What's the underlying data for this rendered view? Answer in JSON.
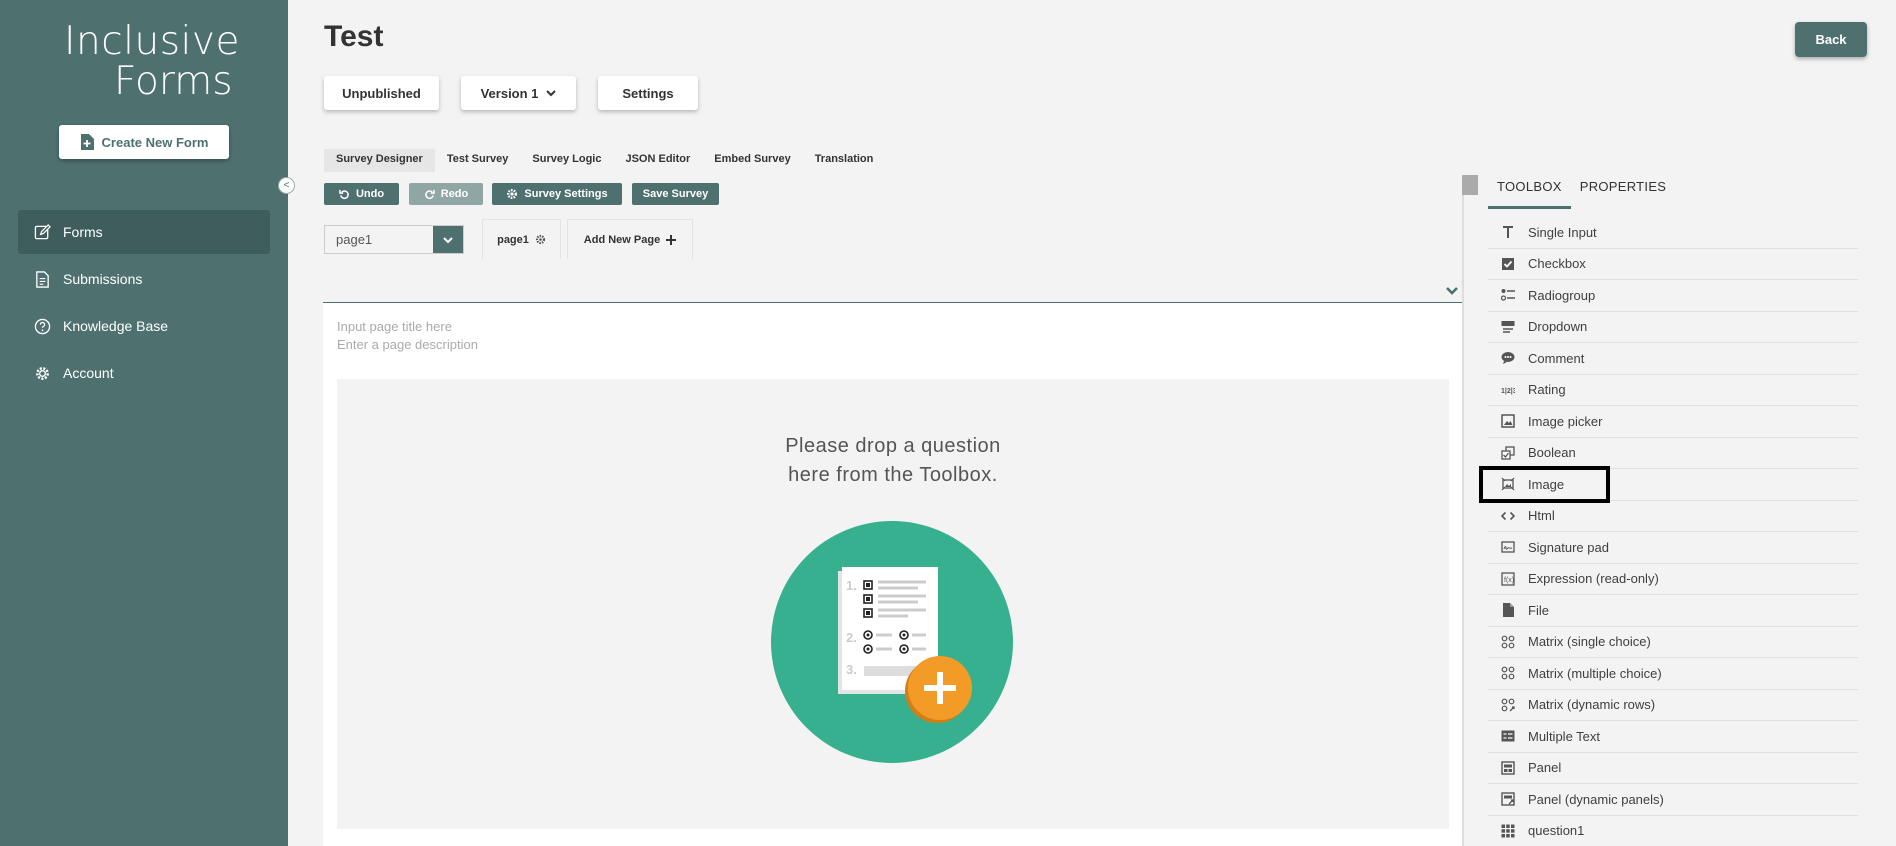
{
  "sidebar": {
    "logo_line1": "Inclusive",
    "logo_line2": "Forms",
    "create_label": "Create New Form",
    "collapse_label": "<",
    "items": [
      {
        "label": "Forms"
      },
      {
        "label": "Submissions"
      },
      {
        "label": "Knowledge Base"
      },
      {
        "label": "Account"
      }
    ]
  },
  "header": {
    "title": "Test",
    "back_label": "Back",
    "status_label": "Unpublished",
    "version_label": "Version 1",
    "settings_label": "Settings"
  },
  "tabs": [
    "Survey Designer",
    "Test Survey",
    "Survey Logic",
    "JSON Editor",
    "Embed Survey",
    "Translation"
  ],
  "toolbar": {
    "undo": "Undo",
    "redo": "Redo",
    "survey_settings": "Survey Settings",
    "save_survey": "Save Survey"
  },
  "pages": {
    "selected": "page1",
    "page_tab": "page1",
    "add_page": "Add New Page"
  },
  "canvas": {
    "title_placeholder": "Input page title here",
    "desc_placeholder": "Enter a page description",
    "drop_line1": "Please drop a question",
    "drop_line2": "here from the Toolbox."
  },
  "right_panel": {
    "tabs": [
      "TOOLBOX",
      "PROPERTIES"
    ],
    "toolbox": [
      {
        "label": "Single Input",
        "icon": "text-icon"
      },
      {
        "label": "Checkbox",
        "icon": "checkbox-icon"
      },
      {
        "label": "Radiogroup",
        "icon": "radiogroup-icon"
      },
      {
        "label": "Dropdown",
        "icon": "dropdown-icon"
      },
      {
        "label": "Comment",
        "icon": "comment-icon"
      },
      {
        "label": "Rating",
        "icon": "rating-icon"
      },
      {
        "label": "Image picker",
        "icon": "image-picker-icon"
      },
      {
        "label": "Boolean",
        "icon": "boolean-icon"
      },
      {
        "label": "Image",
        "icon": "image-icon"
      },
      {
        "label": "Html",
        "icon": "html-icon"
      },
      {
        "label": "Signature pad",
        "icon": "signature-icon"
      },
      {
        "label": "Expression (read-only)",
        "icon": "expression-icon"
      },
      {
        "label": "File",
        "icon": "file-icon"
      },
      {
        "label": "Matrix (single choice)",
        "icon": "matrix-icon"
      },
      {
        "label": "Matrix (multiple choice)",
        "icon": "matrix-icon"
      },
      {
        "label": "Matrix (dynamic rows)",
        "icon": "matrix-dynamic-icon"
      },
      {
        "label": "Multiple Text",
        "icon": "multiple-text-icon"
      },
      {
        "label": "Panel",
        "icon": "panel-icon"
      },
      {
        "label": "Panel (dynamic panels)",
        "icon": "panel-dynamic-icon"
      },
      {
        "label": "question1",
        "icon": "grid-icon"
      }
    ],
    "highlighted_item": "Image"
  },
  "colors": {
    "brand": "#4e7170",
    "illustration_circle": "#36b08f",
    "plus_badge": "#f29b26"
  }
}
